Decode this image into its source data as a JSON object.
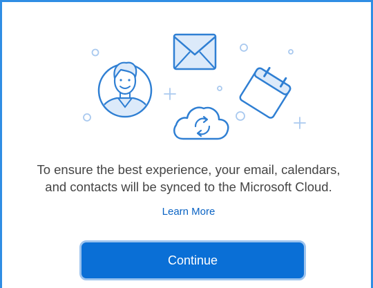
{
  "message": {
    "line1": "To ensure the best experience, your email, calendars,",
    "line2": "and contacts will be synced to the Microsoft Cloud."
  },
  "learn_more_label": "Learn More",
  "continue_label": "Continue",
  "colors": {
    "frame_border": "#2f8de4",
    "illustration_stroke": "#2f7fd3",
    "illustration_fill": "#dceafa",
    "decor_light": "#a9c9ef",
    "link": "#0a63c4",
    "button_bg": "#0a6fd6",
    "button_ring": "#9cc3ee",
    "text": "#444444"
  },
  "illustration": {
    "items": [
      "person-avatar-icon",
      "envelope-icon",
      "calendar-icon",
      "cloud-sync-icon"
    ]
  }
}
